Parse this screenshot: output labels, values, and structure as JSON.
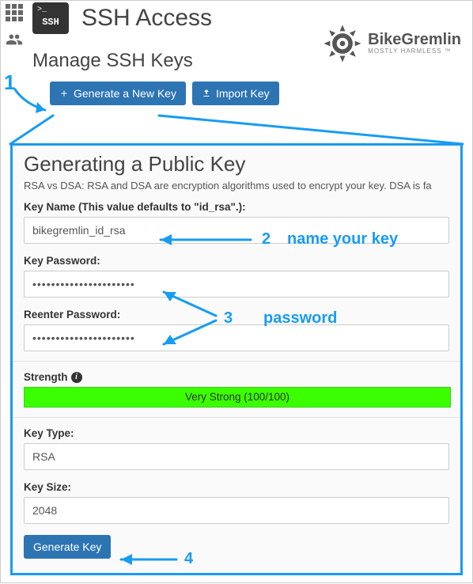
{
  "header": {
    "badge_text": "SSH",
    "title": "SSH Access"
  },
  "subtitle": "Manage SSH Keys",
  "buttons": {
    "generate_new": "Generate a New Key",
    "import": "Import Key"
  },
  "logo": {
    "line1": "BikeGremlin",
    "line2": "MOSTLY HARMLESS ™"
  },
  "annotations": {
    "step1": "1",
    "step2_num": "2",
    "step2_text": "name your key",
    "step3_num": "3",
    "step3_text": "password",
    "step4": "4"
  },
  "modal": {
    "title": "Generating a Public Key",
    "desc": "RSA vs DSA: RSA and DSA are encryption algorithms used to encrypt your key. DSA is fa",
    "key_name_label": "Key Name (This value defaults to \"id_rsa\".):",
    "key_name_value": "bikegremlin_id_rsa",
    "pwd_label": "Key Password:",
    "pwd_value": "••••••••••••••••••••••",
    "pwd2_label": "Reenter Password:",
    "pwd2_value": "••••••••••••••••••••••",
    "strength_label": "Strength",
    "strength_text": "Very Strong (100/100)",
    "type_label": "Key Type:",
    "type_value": "RSA",
    "size_label": "Key Size:",
    "size_value": "2048",
    "submit": "Generate Key"
  }
}
